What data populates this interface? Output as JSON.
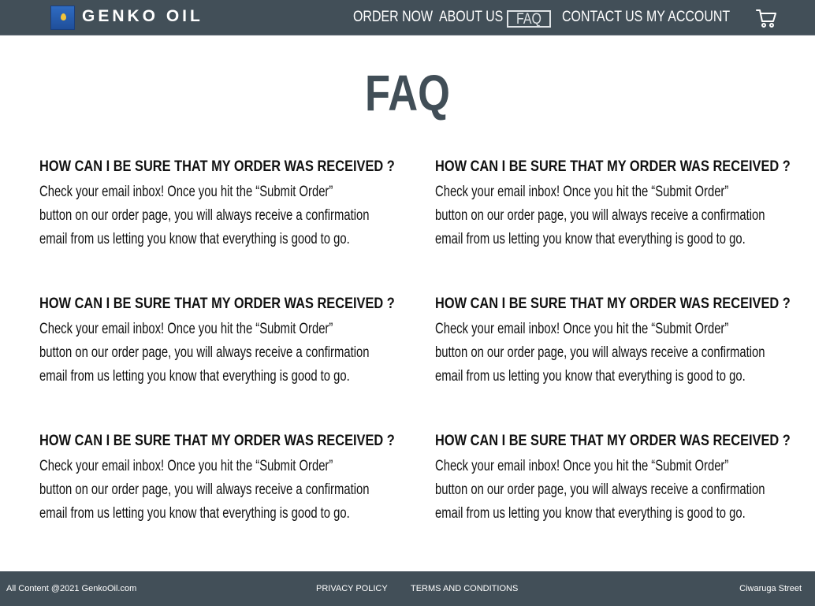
{
  "header": {
    "brand": "GENKO OIL",
    "logo_icon": "oil-drop-icon",
    "nav": {
      "order_now": "ORDER NOW",
      "about_us": "ABOUT US",
      "faq": "FAQ",
      "contact_us": "CONTACT US",
      "my_account": "MY ACCOUNT"
    },
    "active_nav": "FAQ",
    "cart_icon": "shopping-cart-icon",
    "bg_color": "#424f58"
  },
  "page": {
    "title": "FAQ",
    "title_color": "#414e57"
  },
  "faq": [
    {
      "question": "HOW CAN I BE SURE THAT MY ORDER WAS RECEIVED ?",
      "answer_lines": [
        "Check your email inbox! Once you hit the “Submit Order”",
        "button on our order page, you will always receive a confirmation",
        "email from us letting you know that everything is good to go."
      ]
    },
    {
      "question": "HOW CAN I BE SURE THAT MY ORDER WAS RECEIVED ?",
      "answer_lines": [
        "Check your email inbox! Once you hit the “Submit Order”",
        "button on our order page, you will always receive a confirmation",
        "email from us letting you know that everything is good to go."
      ]
    },
    {
      "question": "HOW CAN I BE SURE THAT MY ORDER WAS RECEIVED ?",
      "answer_lines": [
        "Check your email inbox! Once you hit the “Submit Order”",
        "button on our order page, you will always receive a confirmation",
        "email from us letting you know that everything is good to go."
      ]
    },
    {
      "question": "HOW CAN I BE SURE THAT MY ORDER WAS RECEIVED ?",
      "answer_lines": [
        "Check your email inbox! Once you hit the “Submit Order”",
        "button on our order page, you will always receive a confirmation",
        "email from us letting you know that everything is good to go."
      ]
    },
    {
      "question": "HOW CAN I BE SURE THAT MY ORDER WAS RECEIVED ?",
      "answer_lines": [
        "Check your email inbox! Once you hit the “Submit Order”",
        "button on our order page, you will always receive a confirmation",
        "email from us letting you know that everything is good to go."
      ]
    },
    {
      "question": "HOW CAN I BE SURE THAT MY ORDER WAS RECEIVED ?",
      "answer_lines": [
        "Check your email inbox! Once you hit the “Submit Order”",
        "button on our order page, you will always receive a confirmation",
        "email from us letting you know that everything is good to go."
      ]
    }
  ],
  "footer": {
    "copyright": "All Content @2021 GenkoOil.com",
    "privacy": "PRIVACY POLICY",
    "terms": "TERMS AND CONDITIONS",
    "address": "Ciwaruga Street"
  }
}
